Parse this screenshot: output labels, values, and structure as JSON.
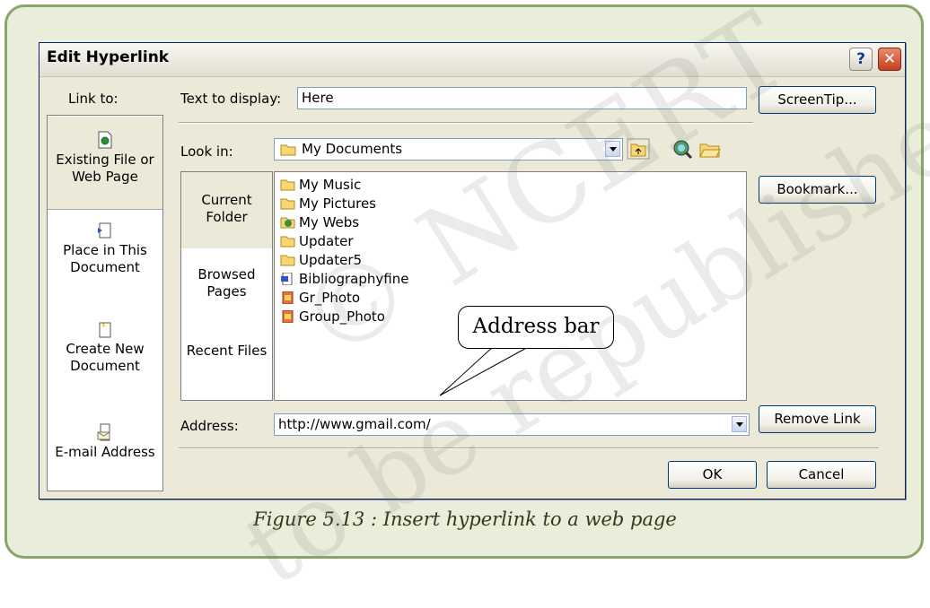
{
  "dialog": {
    "title": "Edit Hyperlink",
    "help_symbol": "?",
    "close_symbol": "✕"
  },
  "link_to": {
    "heading": "Link to:",
    "items": [
      {
        "label": "Existing File or Web Page",
        "icon": "web-page-icon",
        "selected": true
      },
      {
        "label": "Place in This Document",
        "icon": "document-place-icon",
        "selected": false
      },
      {
        "label": "Create New Document",
        "icon": "new-document-icon",
        "selected": false
      },
      {
        "label": "E-mail Address",
        "icon": "email-icon",
        "selected": false
      }
    ]
  },
  "text_to_display": {
    "label": "Text to display:",
    "value": "Here"
  },
  "screentip_button": "ScreenTip...",
  "look_in": {
    "label": "Look in:",
    "value": "My Documents"
  },
  "look_panel": {
    "items": [
      {
        "label": "Current Folder",
        "selected": true
      },
      {
        "label": "Browsed Pages",
        "selected": false
      },
      {
        "label": "Recent Files",
        "selected": false
      }
    ]
  },
  "files": [
    {
      "name": "My Music",
      "icon": "folder-icon"
    },
    {
      "name": "My Pictures",
      "icon": "folder-icon"
    },
    {
      "name": "My Webs",
      "icon": "web-folder-icon"
    },
    {
      "name": "Updater",
      "icon": "folder-icon"
    },
    {
      "name": "Updater5",
      "icon": "folder-icon"
    },
    {
      "name": "Bibliographyfine",
      "icon": "word-document-icon"
    },
    {
      "name": "Gr_Photo",
      "icon": "image-file-icon"
    },
    {
      "name": "Group_Photo",
      "icon": "image-file-icon"
    }
  ],
  "bookmark_button": "Bookmark...",
  "address": {
    "label": "Address:",
    "value": "http://www.gmail.com/"
  },
  "remove_link_button": "Remove Link",
  "ok_button": "OK",
  "cancel_button": "Cancel",
  "annotation": "Address bar",
  "caption": "Figure 5.13 : Insert hyperlink to a web page",
  "watermark": {
    "line1": "© NCERT",
    "line2": "to be republished"
  },
  "colors": {
    "frame_border": "#8aa56a",
    "frame_bg": "#e9edd9",
    "dialog_bg": "#ece9d8"
  }
}
